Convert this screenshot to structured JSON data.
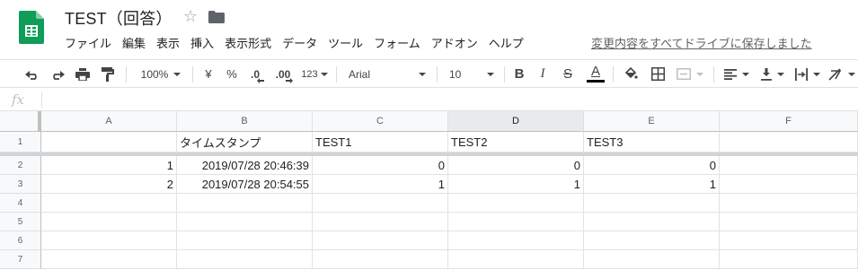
{
  "app": {
    "title": "TEST（回答）",
    "save_status": "変更内容をすべてドライブに保存しました",
    "menu": [
      "ファイル",
      "編集",
      "表示",
      "挿入",
      "表示形式",
      "データ",
      "ツール",
      "フォーム",
      "アドオン",
      "ヘルプ"
    ]
  },
  "toolbar": {
    "zoom": "100%",
    "currency": "¥",
    "percent": "%",
    "decimal_decrease": ".0",
    "decimal_increase": ".00",
    "more_formats": "123",
    "font": "Arial",
    "font_size": "10",
    "bold": "B",
    "italic": "I",
    "strike": "S",
    "text_color": "A",
    "text_color_swatch": "#000000"
  },
  "formula_bar": {
    "label": "fx",
    "value": ""
  },
  "sheet": {
    "columns": [
      "A",
      "B",
      "C",
      "D",
      "E",
      "F"
    ],
    "selected_column": "D",
    "rows": [
      {
        "num": "1",
        "cells": [
          "",
          "タイムスタンプ",
          "TEST1",
          "TEST2",
          "TEST3",
          ""
        ]
      },
      {
        "num": "2",
        "cells": [
          "1",
          "2019/07/28 20:46:39",
          "0",
          "0",
          "0",
          ""
        ]
      },
      {
        "num": "3",
        "cells": [
          "2",
          "2019/07/28 20:54:55",
          "1",
          "1",
          "1",
          ""
        ]
      },
      {
        "num": "4",
        "cells": [
          "",
          "",
          "",
          "",
          "",
          ""
        ]
      },
      {
        "num": "5",
        "cells": [
          "",
          "",
          "",
          "",
          "",
          ""
        ]
      },
      {
        "num": "6",
        "cells": [
          "",
          "",
          "",
          "",
          "",
          ""
        ]
      },
      {
        "num": "7",
        "cells": [
          "",
          "",
          "",
          "",
          "",
          ""
        ]
      }
    ]
  },
  "colors": {
    "sheets_green": "#0F9D58",
    "frozen_bar": "#d0d4d8",
    "selected_header": "#e8eaed"
  }
}
